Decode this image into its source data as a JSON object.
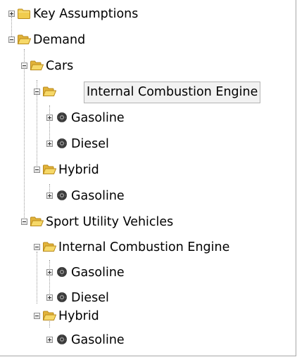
{
  "tree": {
    "key_assumptions": {
      "label": "Key Assumptions",
      "icon": "folder-icon"
    },
    "demand": {
      "label": "Demand",
      "icon": "folder-open-icon",
      "cars": {
        "label": "Cars",
        "ice": {
          "label": "Internal Combustion Engine",
          "selected": true,
          "gasoline": "Gasoline",
          "diesel": "Diesel"
        },
        "hybrid": {
          "label": "Hybrid",
          "gasoline": "Gasoline"
        }
      },
      "suv": {
        "label": "Sport Utility Vehicles",
        "ice": {
          "label": "Internal Combustion Engine",
          "gasoline": "Gasoline",
          "diesel": "Diesel"
        },
        "hybrid": {
          "label": "Hybrid",
          "gasoline": "Gasoline"
        }
      }
    }
  },
  "colors": {
    "folder": "#f0cc4e",
    "folder_border": "#b98a1b",
    "branch_icon": "#3a3a3a",
    "selection_bg": "#f2f2f2"
  }
}
